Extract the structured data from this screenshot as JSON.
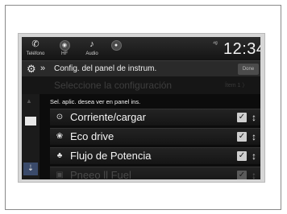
{
  "top_bar": {
    "phone": {
      "icon": "phone-icon",
      "label": "Teléfono"
    },
    "hf": {
      "icon": "hands-free-icon",
      "label": "HF"
    },
    "audio": {
      "icon": "audio-icon",
      "label": "Audio"
    },
    "extra": {
      "icon": "circle-icon"
    },
    "signal_text": "⁴ᵍ",
    "clock": "12:34"
  },
  "title_bar": {
    "title": "Config. del panel de instrum.",
    "done_label": "Done"
  },
  "faded_row": {
    "text": "Seleccione la configuración",
    "right": "Ítem 1 〉"
  },
  "list": {
    "header": "Sel. aplic. desea ver en panel ins.",
    "items": [
      {
        "label": "Corriente/cargar",
        "checked": true
      },
      {
        "label": "Eco drive",
        "checked": true
      },
      {
        "label": "Flujo de Potencia",
        "checked": true
      },
      {
        "label": "Pneeo ll Fuel",
        "checked": true
      }
    ]
  }
}
